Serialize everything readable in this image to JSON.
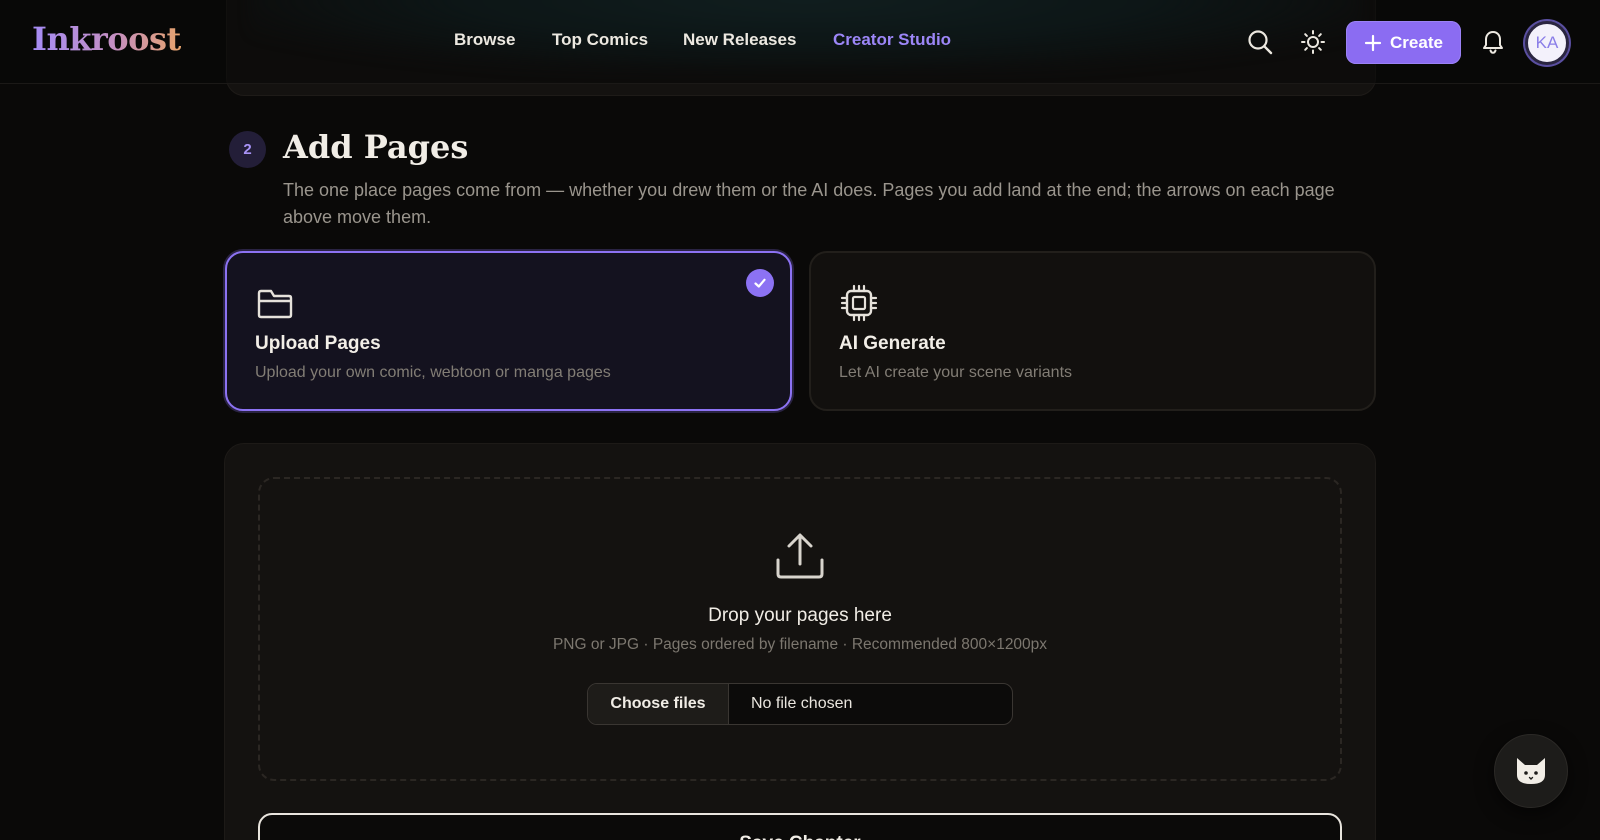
{
  "header": {
    "logo": "Inkroost",
    "nav": [
      {
        "label": "Browse",
        "active": false
      },
      {
        "label": "Top Comics",
        "active": false
      },
      {
        "label": "New Releases",
        "active": false
      },
      {
        "label": "Creator Studio",
        "active": true
      }
    ],
    "search_icon": "search-icon",
    "theme_icon": "sun-icon",
    "create_label": "Create",
    "notification_icon": "bell-icon",
    "avatar_initials": "KA"
  },
  "section": {
    "step_number": "2",
    "title": "Add Pages",
    "description": "The one place pages come from — whether you drew them or the AI does. Pages you add land at the end; the arrows on each page above move them."
  },
  "source_options": [
    {
      "title": "Upload Pages",
      "subtitle": "Upload your own comic, webtoon or manga pages",
      "icon": "folder-icon",
      "selected": true
    },
    {
      "title": "AI Generate",
      "subtitle": "Let AI create your scene variants",
      "icon": "chip-icon",
      "selected": false
    }
  ],
  "upload": {
    "icon": "upload-icon",
    "title": "Drop your pages here",
    "hint": "PNG or JPG · Pages ordered by filename · Recommended 800×1200px",
    "choose_label": "Choose files",
    "file_status": "No file chosen"
  },
  "save_button": "Save Chapter",
  "assistant_icon": "cat-icon",
  "colors": {
    "accent": "#8c72f3",
    "nav_active": "#9c86f7",
    "background": "#0a0908"
  }
}
